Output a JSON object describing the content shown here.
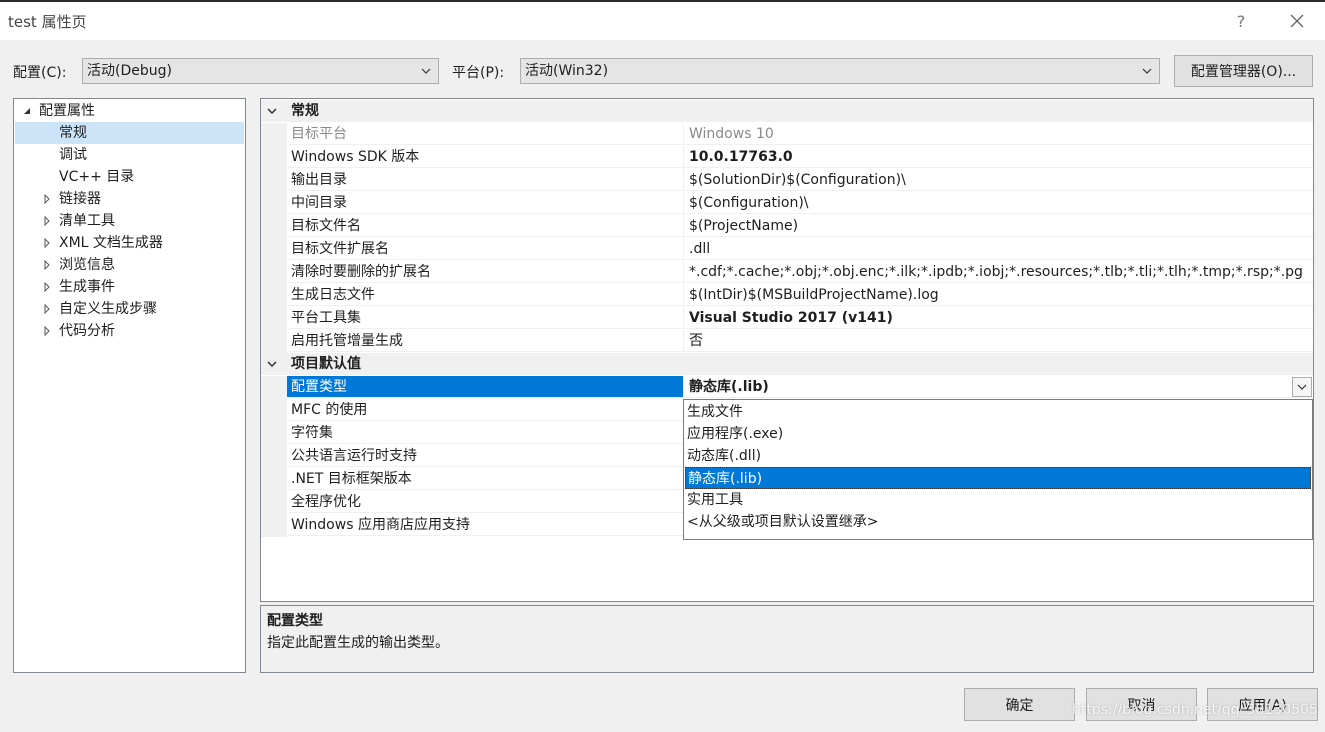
{
  "window": {
    "title": "test 属性页",
    "help_glyph": "?",
    "close_glyph": "✕"
  },
  "config_bar": {
    "config_label": "配置(C):",
    "config_value": "活动(Debug)",
    "platform_label": "平台(P):",
    "platform_value": "活动(Win32)",
    "manager_button": "配置管理器(O)..."
  },
  "tree": {
    "root": "配置属性",
    "items": [
      {
        "label": "常规",
        "expandable": false,
        "selected": true
      },
      {
        "label": "调试",
        "expandable": false
      },
      {
        "label": "VC++ 目录",
        "expandable": false
      },
      {
        "label": "链接器",
        "expandable": true
      },
      {
        "label": "清单工具",
        "expandable": true
      },
      {
        "label": "XML 文档生成器",
        "expandable": true
      },
      {
        "label": "浏览信息",
        "expandable": true
      },
      {
        "label": "生成事件",
        "expandable": true
      },
      {
        "label": "自定义生成步骤",
        "expandable": true
      },
      {
        "label": "代码分析",
        "expandable": true
      }
    ]
  },
  "grid": {
    "categories": [
      {
        "name": "常规",
        "rows": [
          {
            "name": "目标平台",
            "value": "Windows 10",
            "grey": true
          },
          {
            "name": "Windows SDK 版本",
            "value": "10.0.17763.0",
            "bold": true
          },
          {
            "name": "输出目录",
            "value": "$(SolutionDir)$(Configuration)\\"
          },
          {
            "name": "中间目录",
            "value": "$(Configuration)\\"
          },
          {
            "name": "目标文件名",
            "value": "$(ProjectName)"
          },
          {
            "name": "目标文件扩展名",
            "value": ".dll"
          },
          {
            "name": "清除时要删除的扩展名",
            "value": "*.cdf;*.cache;*.obj;*.obj.enc;*.ilk;*.ipdb;*.iobj;*.resources;*.tlb;*.tli;*.tlh;*.tmp;*.rsp;*.pg"
          },
          {
            "name": "生成日志文件",
            "value": "$(IntDir)$(MSBuildProjectName).log"
          },
          {
            "name": "平台工具集",
            "value": "Visual Studio 2017 (v141)",
            "bold": true
          },
          {
            "name": "启用托管增量生成",
            "value": "否"
          }
        ]
      },
      {
        "name": "项目默认值",
        "rows": [
          {
            "name": "配置类型",
            "value": "静态库(.lib)",
            "bold": true,
            "selected": true
          },
          {
            "name": "MFC 的使用",
            "value": ""
          },
          {
            "name": "字符集",
            "value": ""
          },
          {
            "name": "公共语言运行时支持",
            "value": ""
          },
          {
            "name": ".NET 目标框架版本",
            "value": ""
          },
          {
            "name": "全程序优化",
            "value": ""
          },
          {
            "name": "Windows 应用商店应用支持",
            "value": ""
          }
        ]
      }
    ]
  },
  "dropdown": {
    "options": [
      "生成文件",
      "应用程序(.exe)",
      "动态库(.dll)",
      "静态库(.lib)",
      "实用工具",
      "<从父级或项目默认设置继承>"
    ],
    "selected_index": 3
  },
  "description": {
    "title": "配置类型",
    "text": "指定此配置生成的输出类型。"
  },
  "buttons": {
    "ok": "确定",
    "cancel": "取消",
    "apply": "应用(A)"
  },
  "watermark": "https://blog.csdn.net/qq_38130505"
}
